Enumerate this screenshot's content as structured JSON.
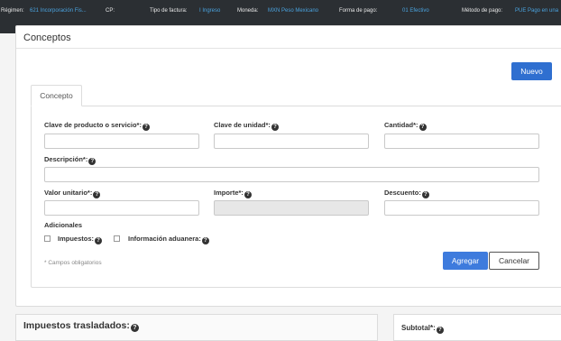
{
  "topbar": {
    "regimen_label": "Régimen:",
    "regimen_value": "621 Incorporación Fis...",
    "cp_label": "CP:",
    "tipo_label": "Tipo de factura:",
    "tipo_value": "I Ingreso",
    "moneda_label": "Moneda:",
    "moneda_value": "MXN Peso Mexicano",
    "forma_label": "Forma de pago:",
    "forma_value": "01 Efectivo",
    "metodo_label": "Método de pago:",
    "metodo_value": "PUE Pago en una"
  },
  "panel": {
    "title": "Conceptos",
    "nuevo_label": "Nuevo",
    "tab_label": "Concepto"
  },
  "form": {
    "clave_producto": "Clave de producto o servicio*:",
    "clave_unidad": "Clave de unidad*:",
    "cantidad": "Cantidad*:",
    "descripcion": "Descripción*:",
    "valor_unitario": "Valor unitario*:",
    "importe": "Importe*:",
    "descuento": "Descuento:",
    "adicionales": "Adicionales",
    "impuestos": "Impuestos:",
    "info_aduanera": "Información aduanera:",
    "required_note": "* Campos obligatorios",
    "agregar": "Agregar",
    "cancelar": "Cancelar",
    "help_glyph": "?"
  },
  "bottom": {
    "impuestos_title": "Impuestos trasladados:",
    "subtotal_title": "Subtotal*:"
  },
  "colors": {
    "topbar_bg": "#2b2f33",
    "accent": "#2f6fd0",
    "link": "#4aa3df"
  }
}
